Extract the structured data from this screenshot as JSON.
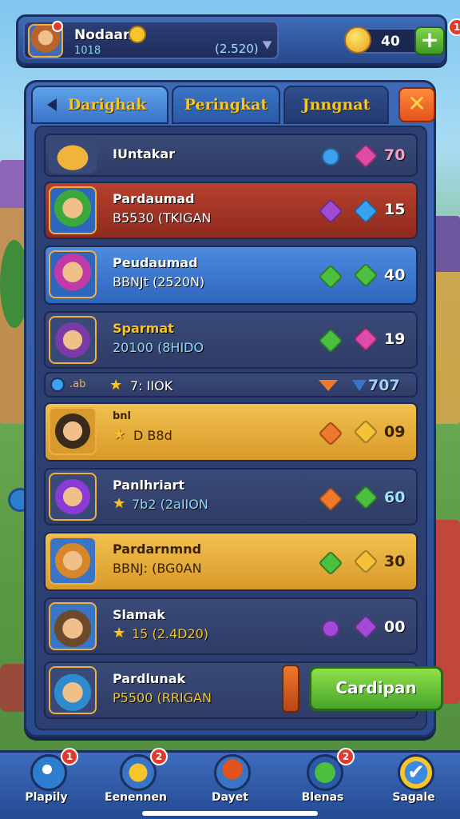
{
  "header": {
    "player_name": "Nodaan",
    "player_sub": "1018",
    "player_score": "(2.520)",
    "currency_value": "40",
    "add_badge": "1"
  },
  "tabs": [
    {
      "label": "Darighak"
    },
    {
      "label": "Peringkat"
    },
    {
      "label": "Jnngnat"
    }
  ],
  "close_label": "✕",
  "rows": [
    {
      "title": "IUntakar",
      "sub": "",
      "value": "70"
    },
    {
      "title": "Pardaumad",
      "sub": "B5530 (TKIGAN",
      "value": "15"
    },
    {
      "title": "Peudaumad",
      "sub": "BBNJt (2520N)",
      "value": "40"
    },
    {
      "title": "Sparmat",
      "sub": "20100 (8HIDO",
      "value": "19"
    },
    {
      "title": "",
      "sub": "7: IIOK",
      "value": "707",
      "left_text": ".ab"
    },
    {
      "title": "bnl",
      "sub": "D B8d",
      "value": "09"
    },
    {
      "title": "Panlhriart",
      "sub": "7b2 (2aIION",
      "value": "60"
    },
    {
      "title": "Pardarnmnd",
      "sub": "BBNJ: (BG0AN",
      "value": "30"
    },
    {
      "title": "Slamak",
      "sub": "15 (2.4D20)",
      "value": "00"
    },
    {
      "title": "Pardlunak",
      "sub": "P5500 (RRIGAN",
      "value": ""
    }
  ],
  "action_button": "Cardipan",
  "nav": [
    {
      "label": "Plapily",
      "badge": "1"
    },
    {
      "label": "Eenennen",
      "badge": "2"
    },
    {
      "label": "Dayet",
      "badge": ""
    },
    {
      "label": "Blenas",
      "badge": "2"
    },
    {
      "label": "Sagale",
      "badge": ""
    }
  ]
}
